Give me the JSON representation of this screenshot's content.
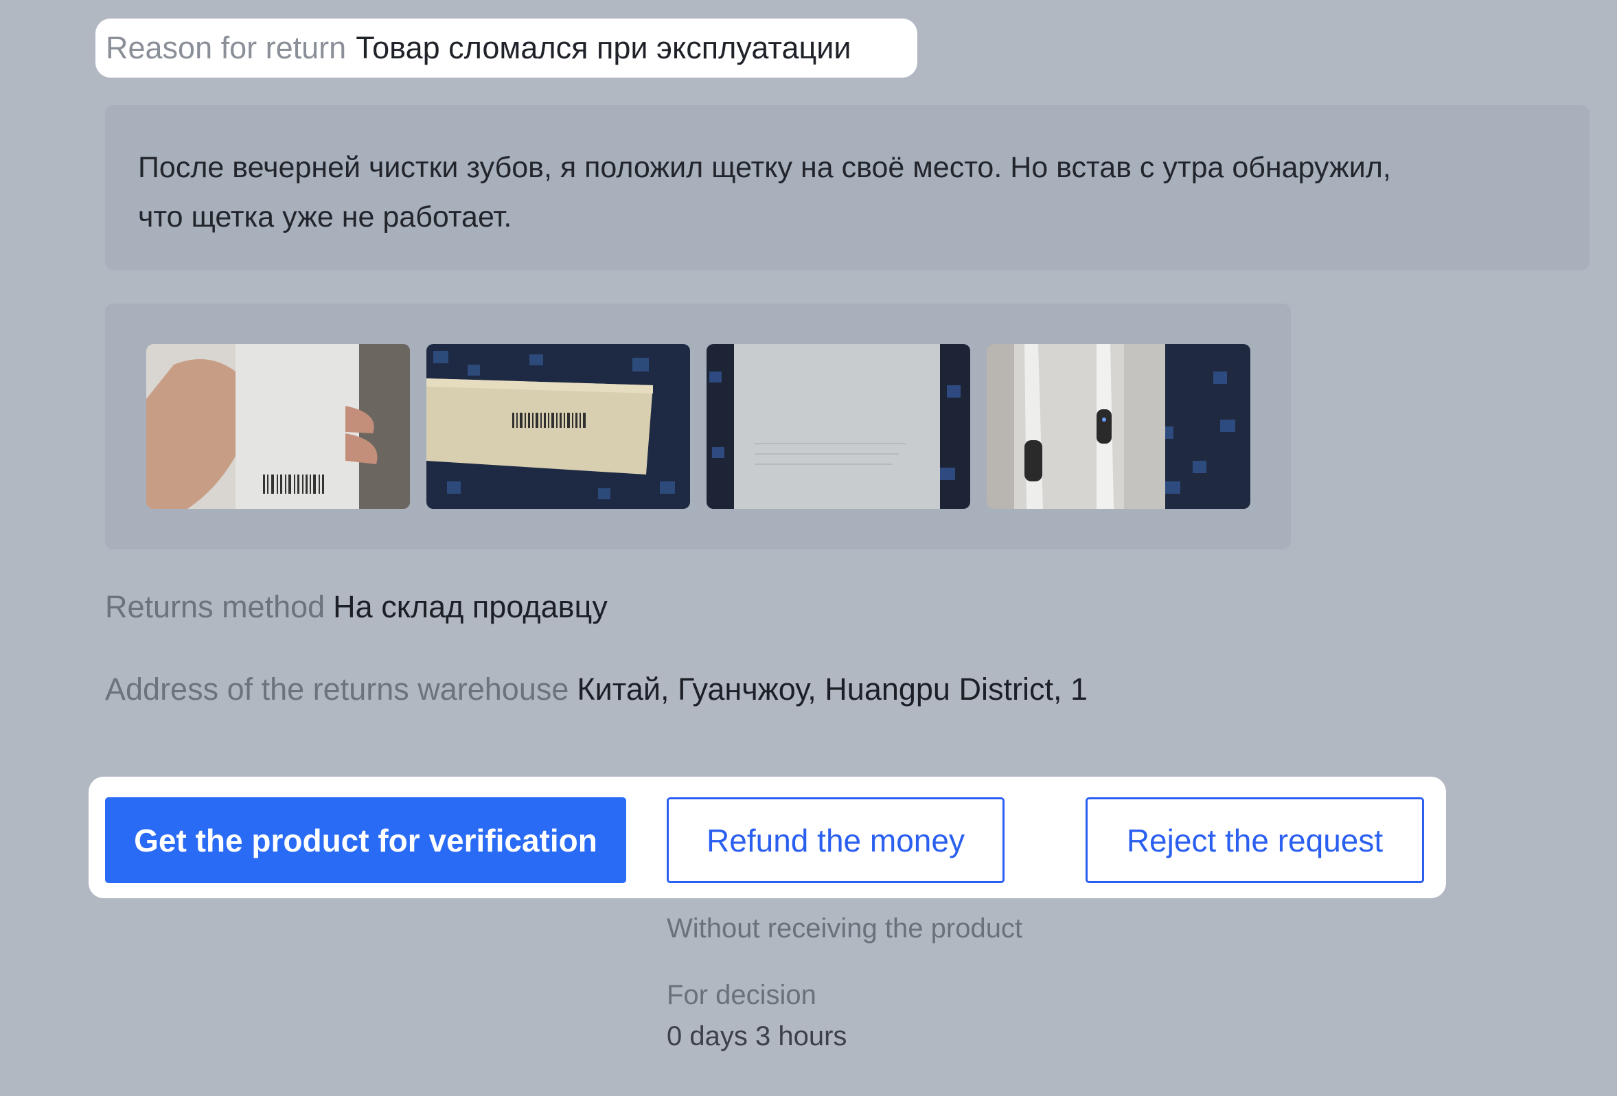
{
  "reason": {
    "label": "Reason for return",
    "value": "Товар сломался при эксплуатации"
  },
  "comment": {
    "line1": "После вечерней чистки зубов, я положил щетку на своё место. Но встав с утра обнаружил,",
    "line2": "что щетка уже не работает."
  },
  "photos": [
    {
      "name": "photo-box-in-hand"
    },
    {
      "name": "photo-box-barcode"
    },
    {
      "name": "photo-box-blank"
    },
    {
      "name": "photo-toothbrush"
    }
  ],
  "returns_method": {
    "label": "Returns method",
    "value": "На склад продавцу"
  },
  "warehouse": {
    "label": "Address of the returns warehouse",
    "value": "Китай, Гуанчжоу, Huangpu District, 1"
  },
  "actions": {
    "verify_label": "Get the product for verification",
    "refund_label": "Refund the money",
    "reject_label": "Reject the request",
    "refund_note": "Without receiving the product"
  },
  "decision": {
    "label": "For decision",
    "time_left": "0 days 3 hours"
  },
  "colors": {
    "background": "#b1b8c2",
    "accent": "#2a6bf5",
    "panel": "#a8b0bb"
  }
}
